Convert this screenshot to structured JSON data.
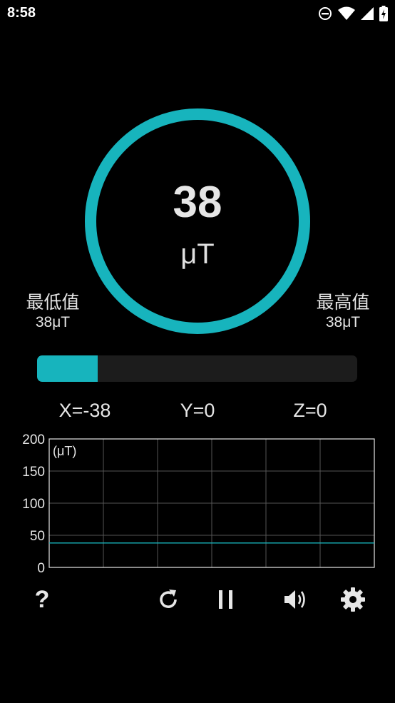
{
  "status_bar": {
    "time": "8:58",
    "icons": [
      "do-not-disturb-icon",
      "wifi-icon",
      "cell-signal-icon",
      "battery-charging-icon"
    ]
  },
  "gauge": {
    "value": "38",
    "unit": "μT",
    "ring_color": "#17b4bd"
  },
  "min": {
    "label": "最低值",
    "value": "38μT"
  },
  "max": {
    "label": "最高值",
    "value": "38μT"
  },
  "progress": {
    "fraction": 0.19,
    "color": "#17b4bd"
  },
  "axes": {
    "x": "X=-38",
    "y": "Y=0",
    "z": "Z=0"
  },
  "chart_data": {
    "type": "line",
    "unit_label": "(μT)",
    "ylim": [
      0,
      200
    ],
    "y_ticks": [
      "200",
      "150",
      "100",
      "50",
      "0"
    ],
    "y_tick_values": [
      200,
      150,
      100,
      50,
      0
    ],
    "grid": true,
    "series": [
      {
        "values": [
          38,
          38,
          38,
          38,
          38,
          38,
          38
        ],
        "color": "#17b4bd"
      }
    ]
  },
  "toolbar": {
    "help_label": "?",
    "buttons": [
      "help-icon",
      "reset-icon",
      "pause-icon",
      "sound-icon",
      "settings-icon"
    ]
  }
}
